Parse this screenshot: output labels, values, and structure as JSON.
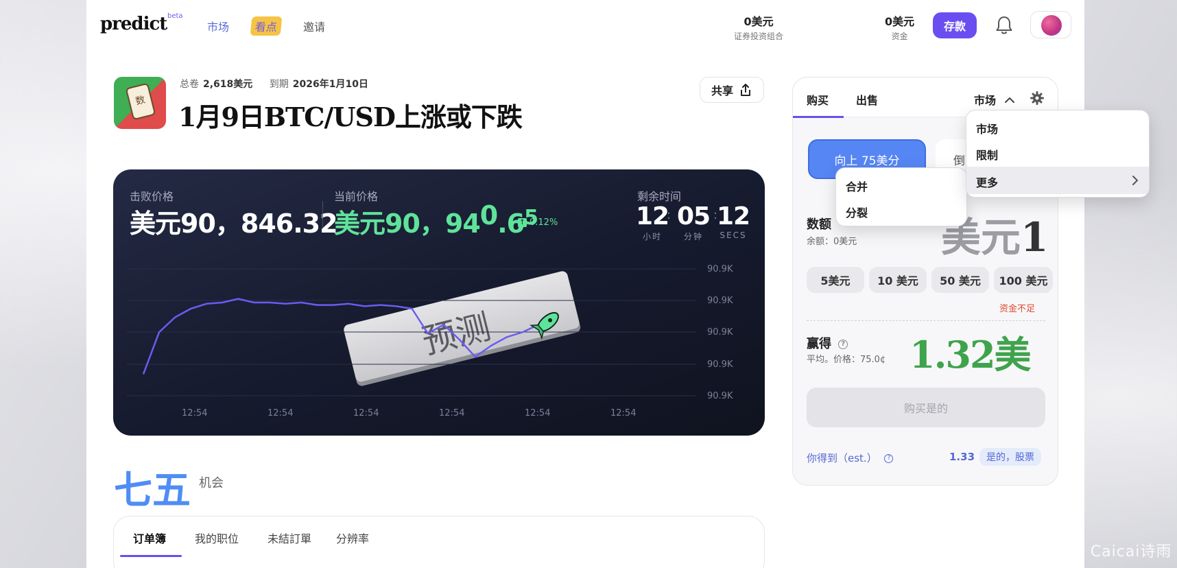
{
  "header": {
    "logo": "predict",
    "logo_badge": "beta",
    "nav": [
      "市场",
      "看点",
      "邀请"
    ],
    "portfolio_value": "0美元",
    "portfolio_label": "证券投资组合",
    "cash_value": "0美元",
    "cash_label": "资金",
    "deposit_label": "存款"
  },
  "market": {
    "icon_glyph": "数",
    "volume_label": "总卷",
    "volume_value": "2,618美元",
    "expiry_label": "到期",
    "expiry_value": "2026年1月10日",
    "title": "1月9日BTC/USD上涨或下跌",
    "share_label": "共享"
  },
  "chart": {
    "strike_label": "击败价格",
    "strike_value": "美元90，846.32",
    "current_label": "当前价格",
    "current_value": "美元90，94",
    "current_digits_a": "0",
    "current_digits_b": ".6",
    "current_digits_c": "5",
    "change_pct": "0.12%",
    "time_label": "剩余时间",
    "hours": "12",
    "hours_unit": "小时",
    "minutes": "05",
    "minutes_unit": "分钟",
    "seconds": "12",
    "seconds_unit": "SECS",
    "stamp_text": "预测"
  },
  "chart_data": {
    "type": "line",
    "x": [
      "12:54",
      "12:54",
      "12:54",
      "12:54",
      "12:54",
      "12:54"
    ],
    "y_ticks": [
      "90.9K",
      "90.9K",
      "90.9K",
      "90.9K",
      "90.9K"
    ],
    "series": [
      {
        "values": [
          0.12,
          0.46,
          0.58,
          0.65,
          0.69,
          0.7,
          0.73,
          0.7,
          0.7,
          0.69,
          0.7,
          0.68,
          0.68,
          0.69,
          0.67,
          0.68,
          0.67,
          0.65,
          0.45,
          0.52,
          0.4,
          0.26,
          0.35,
          0.42,
          0.46,
          0.52
        ]
      }
    ],
    "ylim": [
      0,
      1
    ],
    "grid": true,
    "color": "#6b5cf0"
  },
  "probability": {
    "value": "七五",
    "label": "机会"
  },
  "bottom_tabs": [
    "订单簿",
    "我的职位",
    "未結訂單",
    "分辨率"
  ],
  "trade": {
    "buy_tab": "购买",
    "sell_tab": "出售",
    "order_type": "市场",
    "up_label": "向上  75美分",
    "down_label": "倒下",
    "amount_label": "数额",
    "balance_label": "余额：0美元",
    "amount_prefix": "美元",
    "amount_value": "1",
    "chips": [
      "5美元",
      "10 美元",
      "50 美元",
      "100 美元"
    ],
    "insufficient": "资金不足",
    "win_label": "赢得",
    "avg_price": "平均。价格：75.0¢",
    "win_value": "1.32美元",
    "buy_button": "购买是的",
    "get_label": "你得到（est.）",
    "get_value": "1.33",
    "get_badge": "是的，股票"
  },
  "dropdown_main": [
    "市场",
    "限制",
    "更多"
  ],
  "dropdown_sub": [
    "合并",
    "分裂"
  ],
  "watermark": "@ Caicai诗雨",
  "colors": {
    "accent": "#6b4ef0",
    "up_blue": "#5686f4",
    "green": "#3fa34d",
    "price_green": "#5fe39a",
    "warning": "#e0492e"
  }
}
